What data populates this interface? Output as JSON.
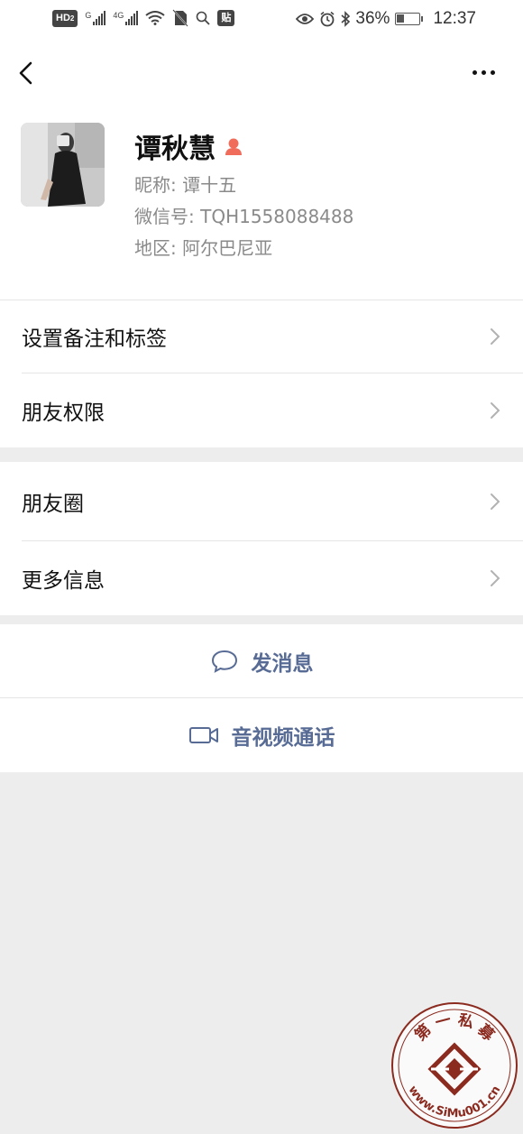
{
  "status_bar": {
    "hd_badge": "HD",
    "hd_sub": "2",
    "sig1_label": "G",
    "sig2_label": "4G",
    "app_badge": "贴",
    "battery_percent": "36%",
    "battery_level": 0.36,
    "time": "12:37"
  },
  "profile": {
    "name": "谭秋慧",
    "gender": "female",
    "nickname_label": "昵称:",
    "nickname": "谭十五",
    "wechat_id_label": "微信号:",
    "wechat_id": "TQH1558088488",
    "region_label": "地区:",
    "region": "阿尔巴尼亚"
  },
  "menu_group1": {
    "items": [
      {
        "label": "设置备注和标签"
      },
      {
        "label": "朋友权限"
      }
    ]
  },
  "menu_group2": {
    "items": [
      {
        "label": "朋友圈"
      },
      {
        "label": "更多信息"
      }
    ]
  },
  "actions": {
    "send_message": "发消息",
    "video_call": "音视频通话"
  },
  "watermark": {
    "top_text": "第 一 私 募",
    "url_text": "www.SiMu001.cn"
  },
  "colors": {
    "link_blue": "#576b95",
    "background_gray": "#ededed",
    "gender_female": "#f06c5b"
  },
  "icons": {
    "back": "chevron-left-icon",
    "more": "more-dots-icon",
    "chat": "chat-bubble-icon",
    "video": "video-camera-icon",
    "row": "chevron-right-icon"
  }
}
